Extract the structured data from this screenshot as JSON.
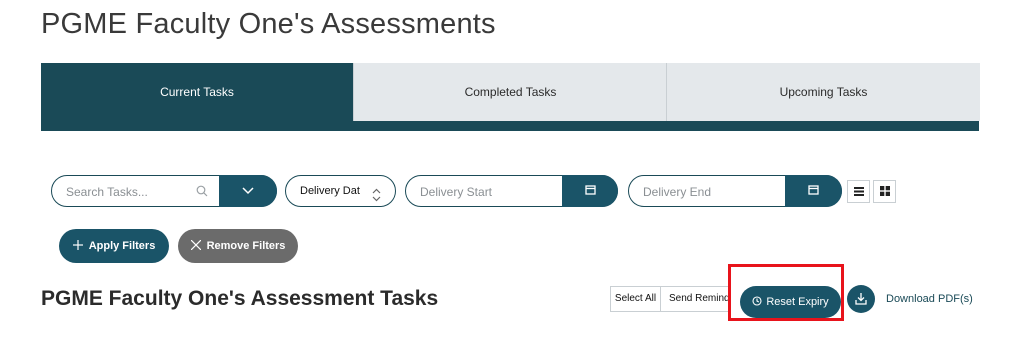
{
  "page": {
    "title": "PGME Faculty One's Assessments"
  },
  "tabs": [
    {
      "label": "Current Tasks",
      "active": true
    },
    {
      "label": "Completed Tasks",
      "active": false
    },
    {
      "label": "Upcoming Tasks",
      "active": false
    }
  ],
  "filters": {
    "search_placeholder": "Search Tasks...",
    "sort_select_value": "Delivery Date",
    "delivery_start_placeholder": "Delivery Start",
    "delivery_end_placeholder": "Delivery End",
    "apply_label": "Apply Filters",
    "remove_label": "Remove Filters"
  },
  "tasks": {
    "heading": "PGME Faculty One's Assessment Tasks",
    "select_all_label": "Select All",
    "send_reminder_label": "Send Reminders",
    "reset_expiry_label": "Reset Expiry",
    "download_label": "Download PDF(s)"
  },
  "colors": {
    "primary": "#1a4a57",
    "button": "#1a5468",
    "gray_button": "#6b6b6b",
    "highlight": "#e8131b"
  }
}
